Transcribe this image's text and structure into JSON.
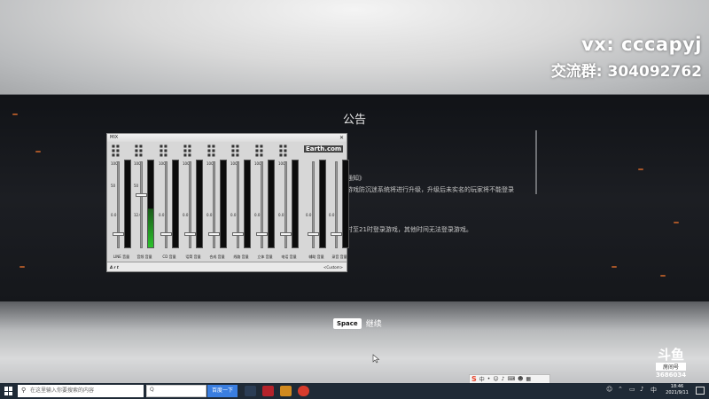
{
  "stream_overlay": {
    "vx_line": "vx: cccapyj",
    "group_line": "交流群: 304092762"
  },
  "notice": {
    "title": "公告",
    "lines": [
      "通知》",
      "游戏防沉迷系统将进行升级，升级后未实名的玩家将不能登录",
      "时至21时登录游戏，其他时间无法登录游戏。"
    ]
  },
  "prompt": {
    "key": "Space",
    "text": "继续"
  },
  "mixer": {
    "title": "MIX",
    "close": "✕",
    "brand": "Earth.com",
    "status_left": "A r t",
    "status_right": "<Custom>",
    "channels": [
      {
        "label": "LINE 音量",
        "scale_top": "100",
        "scale_mid": "50",
        "scale_low": "0.0",
        "level": 0.15,
        "lit": false
      },
      {
        "label": "音频 音量",
        "scale_top": "100",
        "scale_mid": "50",
        "scale_low": "12.0",
        "level": 0.62,
        "lit": true
      },
      {
        "label": "CD 音量",
        "scale_top": "100",
        "scale_mid": "",
        "scale_low": "0.0",
        "level": 0.15,
        "lit": false
      },
      {
        "label": "话筒 音量",
        "scale_top": "100",
        "scale_mid": "",
        "scale_low": "0.0",
        "level": 0.15,
        "lit": false
      },
      {
        "label": "合成 音量",
        "scale_top": "100",
        "scale_mid": "",
        "scale_low": "0.0",
        "level": 0.15,
        "lit": false
      },
      {
        "label": "线路 音量",
        "scale_top": "100",
        "scale_mid": "",
        "scale_low": "0.0",
        "level": 0.15,
        "lit": false
      },
      {
        "label": "立体 音量",
        "scale_top": "100",
        "scale_mid": "",
        "scale_low": "0.0",
        "level": 0.15,
        "lit": false
      },
      {
        "label": "电话 音量",
        "scale_top": "100",
        "scale_mid": "",
        "scale_low": "0.0",
        "level": 0.15,
        "lit": false
      },
      {
        "label": "辅助 音量",
        "scale_top": "",
        "scale_mid": "",
        "scale_low": "0.0",
        "level": 0.15,
        "lit": false
      },
      {
        "label": "录音 音量",
        "scale_top": "",
        "scale_mid": "",
        "scale_low": "0.0",
        "level": 0.15,
        "lit": false
      }
    ]
  },
  "watermark": {
    "logo": "斗鱼",
    "sub": "房间号",
    "room": "3686034"
  },
  "taskbar": {
    "search_placeholder": "在这里输入你要搜索的内容",
    "bing_button": "百度一下",
    "clock_time": "18:46",
    "clock_date": "2021/9/11"
  }
}
